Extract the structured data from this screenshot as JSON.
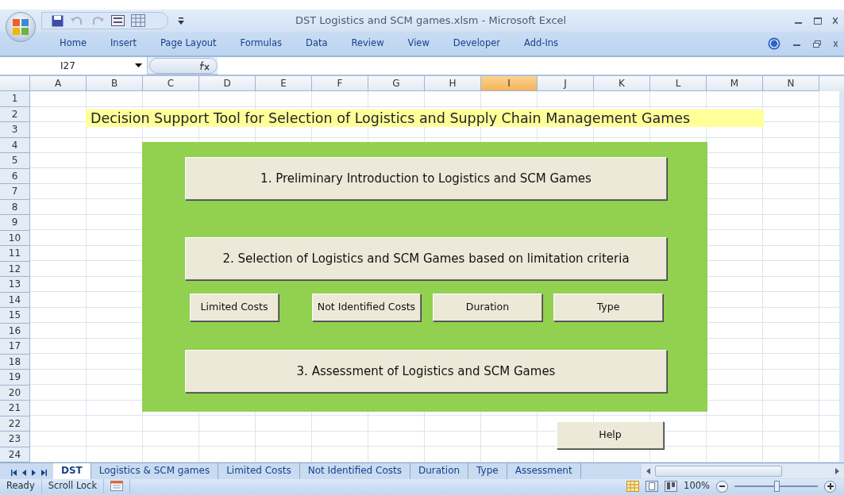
{
  "window": {
    "title": "DST Logistics and SCM games.xlsm - Microsoft Excel"
  },
  "ribbon": {
    "tabs": [
      {
        "label": "Home",
        "selected": false
      },
      {
        "label": "Insert",
        "selected": false
      },
      {
        "label": "Page Layout",
        "selected": false
      },
      {
        "label": "Formulas",
        "selected": false
      },
      {
        "label": "Data",
        "selected": false
      },
      {
        "label": "Review",
        "selected": false
      },
      {
        "label": "View",
        "selected": false
      },
      {
        "label": "Developer",
        "selected": false
      },
      {
        "label": "Add-Ins",
        "selected": false
      }
    ]
  },
  "formula_bar": {
    "name_box": "I27"
  },
  "columns": [
    {
      "label": "A",
      "selected": false
    },
    {
      "label": "B",
      "selected": false
    },
    {
      "label": "C",
      "selected": false
    },
    {
      "label": "D",
      "selected": false
    },
    {
      "label": "E",
      "selected": false
    },
    {
      "label": "F",
      "selected": false
    },
    {
      "label": "G",
      "selected": false
    },
    {
      "label": "H",
      "selected": false
    },
    {
      "label": "I",
      "selected": true
    },
    {
      "label": "J",
      "selected": false
    },
    {
      "label": "K",
      "selected": false
    },
    {
      "label": "L",
      "selected": false
    },
    {
      "label": "M",
      "selected": false
    },
    {
      "label": "N",
      "selected": false
    }
  ],
  "rows": [
    "1",
    "2",
    "3",
    "4",
    "5",
    "6",
    "7",
    "8",
    "9",
    "10",
    "11",
    "12",
    "13",
    "14",
    "15",
    "16",
    "17",
    "18",
    "19",
    "20",
    "21",
    "22",
    "23",
    "24"
  ],
  "sheet": {
    "title": "Decision Support Tool for Selection of Logistics and Supply Chain Management Games",
    "panel": {
      "buttons": [
        {
          "label": "1. Preliminary Introduction to Logistics and SCM Games",
          "kind": "large"
        },
        {
          "label": "2. Selection of Logistics and SCM Games based on limitation criteria",
          "kind": "large"
        },
        {
          "label": "Limited Costs",
          "kind": "small"
        },
        {
          "label": "Not Identified Costs",
          "kind": "small"
        },
        {
          "label": "Duration",
          "kind": "small"
        },
        {
          "label": "Type",
          "kind": "small"
        },
        {
          "label": "3. Assessment of Logistics and SCM Games",
          "kind": "large"
        }
      ]
    },
    "help_button": "Help"
  },
  "sheet_tabs": [
    {
      "label": "DST",
      "selected": true
    },
    {
      "label": "Logistics & SCM games",
      "selected": false
    },
    {
      "label": "Limited Costs",
      "selected": false
    },
    {
      "label": "Not Identified Costs",
      "selected": false
    },
    {
      "label": "Duration",
      "selected": false
    },
    {
      "label": "Type",
      "selected": false
    },
    {
      "label": "Assessment",
      "selected": false
    }
  ],
  "status_bar": {
    "items": [
      "Ready",
      "Scroll Lock"
    ],
    "zoom": "100%",
    "zoom_slider": {
      "level": 0.5
    }
  }
}
